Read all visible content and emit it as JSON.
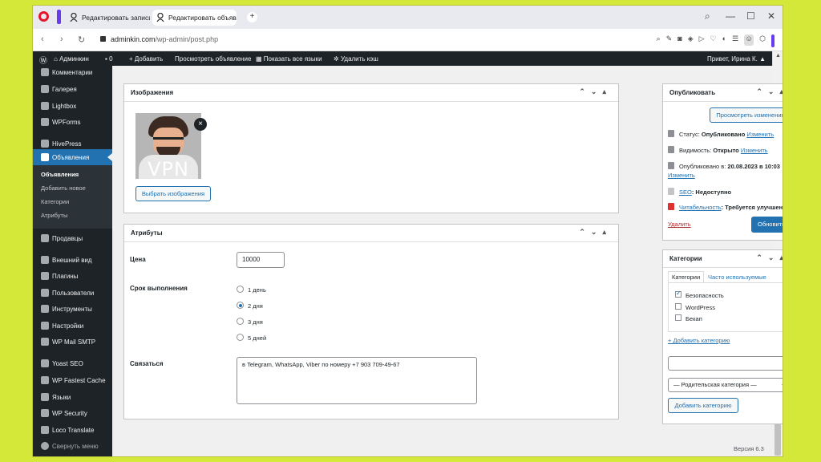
{
  "browser": {
    "tabs": [
      {
        "label": "Редактировать запись ‹"
      },
      {
        "label": "Редактировать объявле"
      }
    ],
    "url_host": "adminkin.com",
    "url_path": "/wp-admin/post.php"
  },
  "adminbar": {
    "site": "Админкин",
    "comments": "0",
    "add": "Добавить",
    "view": "Просмотреть объявление",
    "show_langs": "Показать все языки",
    "clear_cache": "Удалить кэш",
    "greeting": "Привет, Ирина К."
  },
  "sidebar": {
    "items": [
      {
        "label": "Комментарии"
      },
      {
        "label": "Галерея"
      },
      {
        "label": "Lightbox"
      },
      {
        "label": "WPForms"
      },
      {
        "label": "HivePress"
      },
      {
        "label": "Объявления"
      },
      {
        "label": "Продавцы"
      },
      {
        "label": "Внешний вид"
      },
      {
        "label": "Плагины"
      },
      {
        "label": "Пользователи"
      },
      {
        "label": "Инструменты"
      },
      {
        "label": "Настройки"
      },
      {
        "label": "WP Mail SMTP"
      },
      {
        "label": "Yoast SEO"
      },
      {
        "label": "WP Fastest Cache"
      },
      {
        "label": "Языки"
      },
      {
        "label": "WP Security"
      },
      {
        "label": "Loco Translate"
      },
      {
        "label": "Свернуть меню"
      }
    ],
    "submenu": [
      "Объявления",
      "Добавить новое",
      "Категории",
      "Атрибуты"
    ]
  },
  "images_box": {
    "title": "Изображения",
    "thumb_text": "VPN",
    "choose_button": "Выбрать изображения"
  },
  "attributes_box": {
    "title": "Атрибуты",
    "price_label": "Цена",
    "price_value": "10000",
    "term_label": "Срок выполнения",
    "term_options": [
      "1 день",
      "2 дня",
      "3 дня",
      "5 дней"
    ],
    "term_selected": "2 дня",
    "contact_label": "Связаться",
    "contact_value": "в Telegram, WhatsApp, Viber по номеру +7 903 709-49-67"
  },
  "publish_box": {
    "title": "Опубликовать",
    "preview_button": "Просмотреть изменения",
    "status_label": "Статус:",
    "status_value": "Опубликовано",
    "visibility_label": "Видимость:",
    "visibility_value": "Открыто",
    "published_label": "Опубликовано в:",
    "published_value": "20.08.2023 в 10:03",
    "edit_link": "Изменить",
    "seo_label": "SEO",
    "seo_value": ": Недоступно",
    "readability_label": "Читабельность",
    "readability_value": ": Требуется улучшение",
    "delete_link": "Удалить",
    "update_button": "Обновить"
  },
  "categories_box": {
    "title": "Категории",
    "tab_all": "Категории",
    "tab_popular": "Часто используемые",
    "items": [
      {
        "label": "Безопасность",
        "checked": true
      },
      {
        "label": "WordPress",
        "checked": false
      },
      {
        "label": "Бекап",
        "checked": false
      }
    ],
    "add_link": "+ Добавить категорию",
    "parent_select": "— Родительская категория —",
    "add_button": "Добавить категорию"
  },
  "footer": {
    "version": "Версия 6.3"
  }
}
